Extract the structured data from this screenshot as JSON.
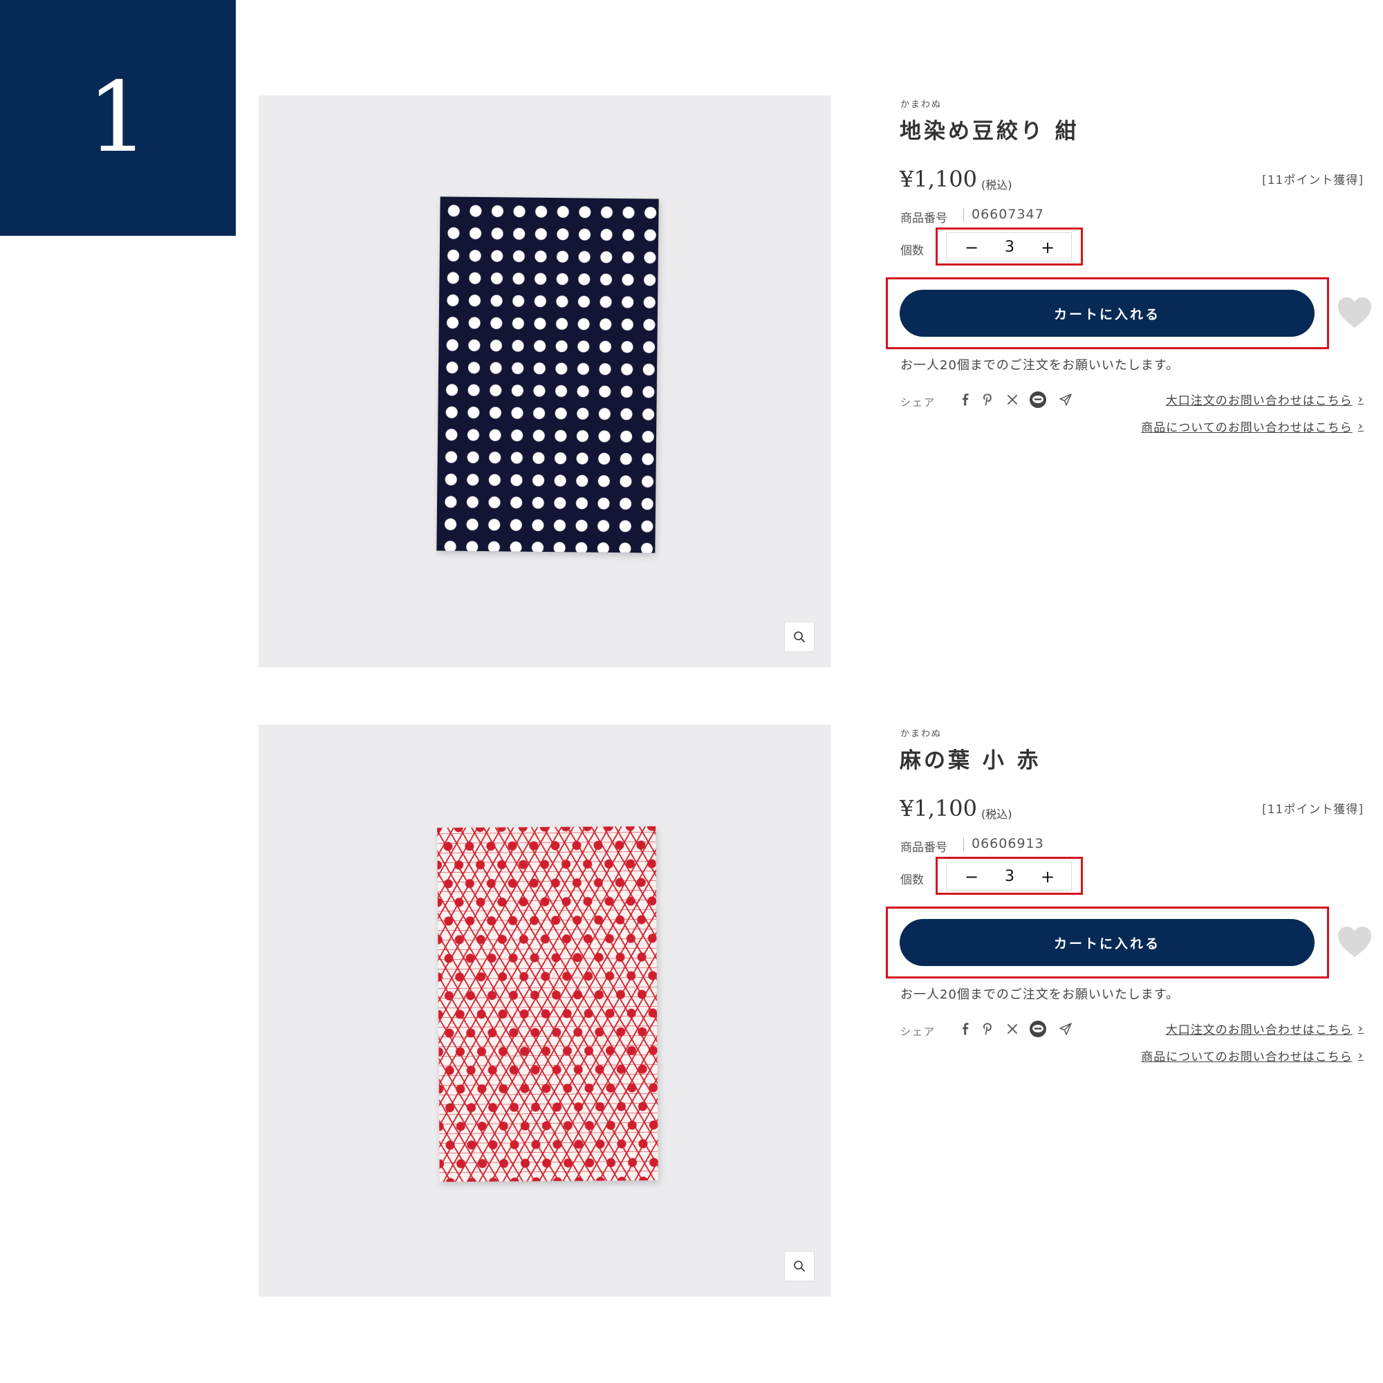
{
  "step_number": "1",
  "products": [
    {
      "ruby": "かまわぬ",
      "title": "地染め豆絞り 紺",
      "price": "¥1,100",
      "tax_note": "(税込)",
      "points": "[11ポイント獲得]",
      "code_label": "商品番号",
      "code_value": "06607347",
      "qty_label": "個数",
      "qty_minus": "−",
      "qty_value": "3",
      "qty_plus": "+",
      "cart_label": "カートに入れる",
      "limit_note": "お一人20個までのご注文をお願いいたします。",
      "share_label": "シェア",
      "bulk_inquiry_link": "大口注文のお問い合わせはこちら",
      "product_inquiry_link": "商品についてのお問い合わせはこちら",
      "photo_pattern": "navy-polka-dot"
    },
    {
      "ruby": "かまわぬ",
      "title": "麻の葉 小 赤",
      "price": "¥1,100",
      "tax_note": "(税込)",
      "points": "[11ポイント獲得]",
      "code_label": "商品番号",
      "code_value": "06606913",
      "qty_label": "個数",
      "qty_minus": "−",
      "qty_value": "3",
      "qty_plus": "+",
      "cart_label": "カートに入れる",
      "limit_note": "お一人20個までのご注文をお願いいたします。",
      "share_label": "シェア",
      "bulk_inquiry_link": "大口注文のお問い合わせはこちら",
      "product_inquiry_link": "商品についてのお問い合わせはこちら",
      "photo_pattern": "red-asanoha"
    }
  ],
  "share_icons": [
    "facebook-icon",
    "pinterest-icon",
    "x-icon",
    "line-icon",
    "send-icon"
  ],
  "colors": {
    "brand_navy": "#062a55",
    "highlight_red": "#d4141f",
    "photo_background": "#ececef",
    "favorite_gray": "#d9d9d9"
  }
}
